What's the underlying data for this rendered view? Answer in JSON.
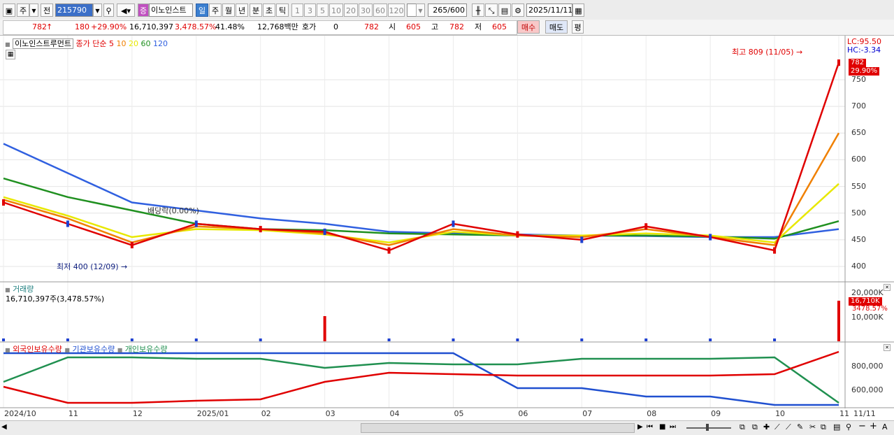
{
  "toolbar": {
    "period_label": "주",
    "prev_label": "전",
    "code_value": "215790",
    "name_badge": "증",
    "name_value": "이노인스트",
    "periods": [
      "일",
      "주",
      "월",
      "년",
      "분",
      "초",
      "틱"
    ],
    "minutes": [
      "1",
      "3",
      "5",
      "10",
      "20",
      "30",
      "60",
      "120"
    ],
    "count_value": "265",
    "count_total": "/600",
    "date_value": "2025/11/11"
  },
  "quote": {
    "price": "782",
    "arrow": "↑",
    "change": "180",
    "change_pct": "+29.90%",
    "volume": "16,710,397",
    "volume_pct": "3,478.57%",
    "turnover": "41.48%",
    "amount": "12,768백만",
    "hoga_label": "호가",
    "hoga_value": "0",
    "hoga_price": "782",
    "open_label": "시",
    "open_value": "605",
    "high_label": "고",
    "high_value": "782",
    "low_label": "저",
    "low_value": "605",
    "buy_label": "매수",
    "sell_label": "매도",
    "eval_label": "평"
  },
  "price_panel": {
    "title": "이노인스트루먼트",
    "legend_prefix": "종가 단순",
    "ma": [
      {
        "label": "5",
        "color": "#e00000"
      },
      {
        "label": "10",
        "color": "#f08000"
      },
      {
        "label": "20",
        "color": "#e8e800"
      },
      {
        "label": "60",
        "color": "#209020"
      },
      {
        "label": "120",
        "color": "#3060e0"
      }
    ],
    "lc": "LC:95.50",
    "hc": "HC:-3.34",
    "high_annotation": "최고 809 (11/05) →",
    "low_annotation": "최저 400 (12/09) →",
    "dividend": "배당락(0.00%)",
    "current_price_badge": "782",
    "current_pct_badge": "29.90%",
    "y_ticks": [
      "750",
      "700",
      "650",
      "600",
      "550",
      "500",
      "450",
      "400"
    ]
  },
  "volume_panel": {
    "title": "거래량",
    "value_line": "16,710,397주(3,478.57%)",
    "badge": "16,710K",
    "badge_pct": "3478.57%",
    "y_ticks": [
      "20,000K",
      "10,000K"
    ]
  },
  "holding_panel": {
    "legend": [
      {
        "label": "외국인보유수량",
        "color": "#e00000"
      },
      {
        "label": "기관보유수량",
        "color": "#2050d0"
      },
      {
        "label": "개인보유수량",
        "color": "#209050"
      }
    ],
    "y_ticks": [
      "800,000",
      "600,000"
    ]
  },
  "x_axis": [
    "2024/10",
    "11",
    "12",
    "2025/01",
    "02",
    "03",
    "04",
    "05",
    "06",
    "07",
    "08",
    "09",
    "10",
    "11",
    "11/11"
  ],
  "chart_data": {
    "type": "line",
    "title": "이노인스트루먼트",
    "ylim": [
      380,
      820
    ],
    "x": [
      "2024/10",
      "11",
      "12",
      "2025/01",
      "02",
      "03",
      "04",
      "05",
      "06",
      "07",
      "08",
      "09",
      "10",
      "11"
    ],
    "series": [
      {
        "name": "5",
        "values": [
          520,
          480,
          440,
          480,
          470,
          465,
          430,
          480,
          460,
          450,
          475,
          455,
          430,
          782
        ]
      },
      {
        "name": "10",
        "values": [
          525,
          490,
          445,
          475,
          470,
          462,
          440,
          470,
          458,
          455,
          470,
          455,
          440,
          650
        ]
      },
      {
        "name": "20",
        "values": [
          530,
          495,
          455,
          470,
          468,
          460,
          445,
          465,
          458,
          458,
          462,
          458,
          445,
          555
        ]
      },
      {
        "name": "60",
        "values": [
          565,
          530,
          505,
          480,
          470,
          468,
          462,
          460,
          458,
          458,
          458,
          456,
          452,
          485
        ]
      },
      {
        "name": "120",
        "values": [
          630,
          575,
          520,
          505,
          490,
          480,
          465,
          462,
          460,
          458,
          457,
          455,
          455,
          470
        ]
      }
    ],
    "annotations": {
      "high": 809,
      "high_date": "11/05",
      "low": 400,
      "low_date": "12/09"
    }
  }
}
